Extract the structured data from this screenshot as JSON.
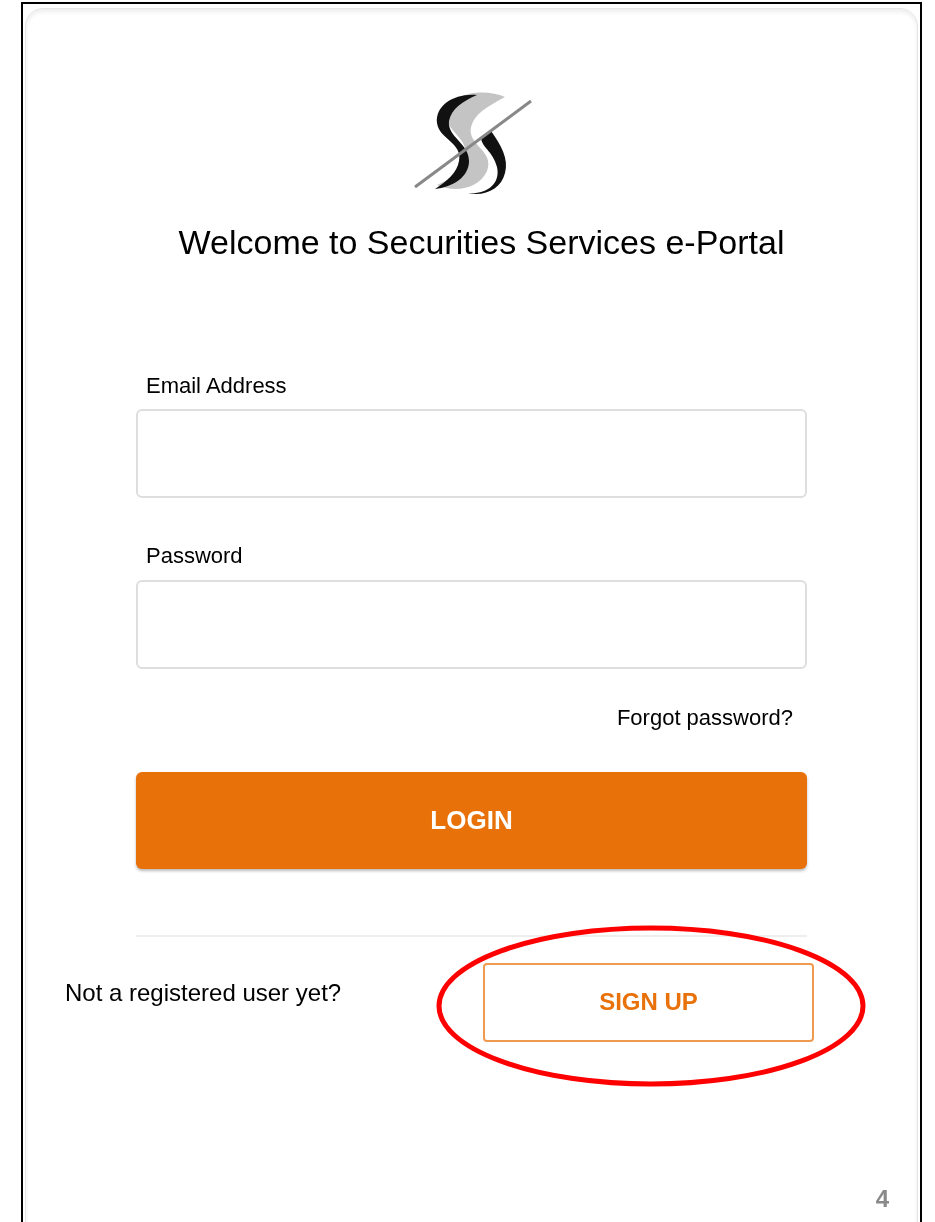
{
  "title": "Welcome to Securities Services e-Portal",
  "fields": [
    {
      "label": "Email Address"
    },
    {
      "label": "Password"
    }
  ],
  "forgot_link": "Forgot password?",
  "login_button": "LOGIN",
  "signup": {
    "prompt": "Not a registered user yet?",
    "button": "SIGN UP"
  },
  "page_number": "4"
}
